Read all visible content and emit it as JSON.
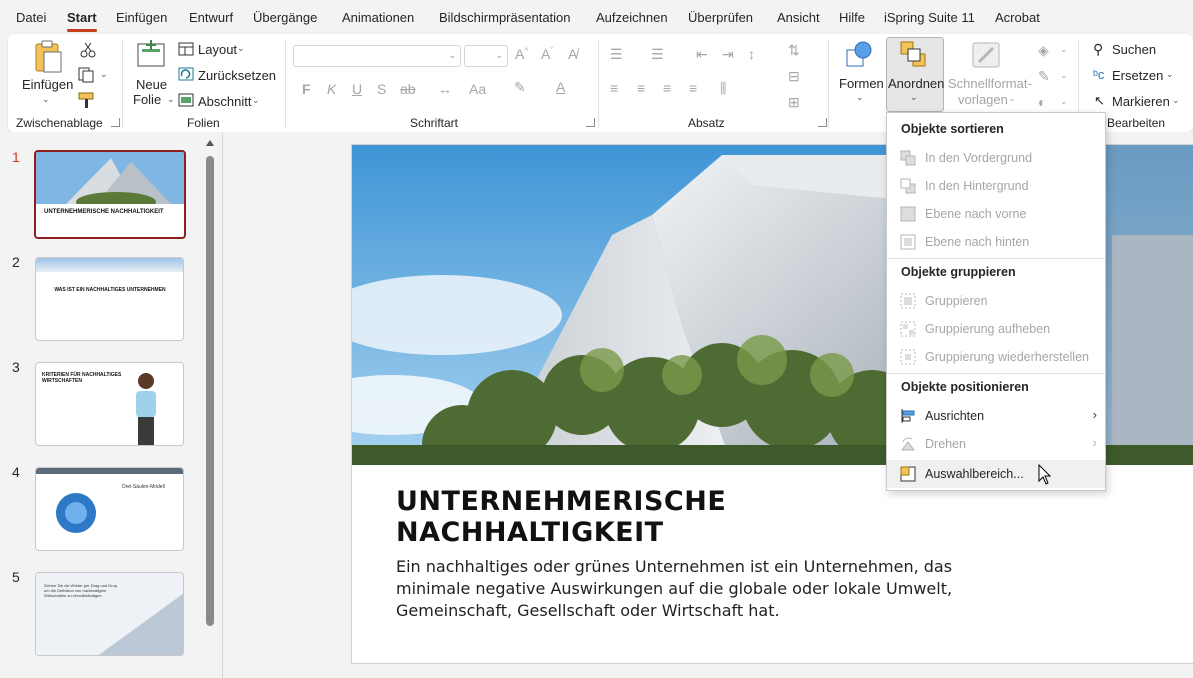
{
  "menubar": {
    "tabs": [
      {
        "label": "Datei"
      },
      {
        "label": "Start",
        "active": true
      },
      {
        "label": "Einfügen"
      },
      {
        "label": "Entwurf"
      },
      {
        "label": "Übergänge"
      },
      {
        "label": "Animationen"
      },
      {
        "label": "Bildschirmpräsentation"
      },
      {
        "label": "Aufzeichnen"
      },
      {
        "label": "Überprüfen"
      },
      {
        "label": "Ansicht"
      },
      {
        "label": "Hilfe"
      },
      {
        "label": "iSpring Suite 11"
      },
      {
        "label": "Acrobat"
      }
    ]
  },
  "ribbon": {
    "clipboard": {
      "paste_label": "Einfügen",
      "group_label": "Zwischenablage"
    },
    "slides": {
      "new_slide_line1": "Neue",
      "new_slide_line2": "Folie",
      "layout": "Layout",
      "reset": "Zurücksetzen",
      "section": "Abschnitt",
      "group_label": "Folien"
    },
    "font": {
      "group_label": "Schriftart",
      "bold": "F",
      "italic": "K",
      "underline": "U",
      "shadow": "S",
      "strike": "ab",
      "case": "Aa"
    },
    "paragraph": {
      "group_label": "Absatz"
    },
    "drawing": {
      "shapes_label": "Formen",
      "arrange_label": "Anordnen",
      "quickstyles_line1": "Schnellformat-",
      "quickstyles_line2": "vorlagen"
    },
    "editing": {
      "search": "Suchen",
      "replace": "Ersetzen",
      "select": "Markieren",
      "group_label": "Bearbeiten"
    }
  },
  "thumbnails": {
    "slides": [
      {
        "number": "1",
        "selected": true,
        "title": "UNTERNEHMERISCHE NACHHALTIGKEIT"
      },
      {
        "number": "2",
        "title": "WAS IST EIN NACHHALTIGES UNTERNEHMEN"
      },
      {
        "number": "3",
        "title": "KRITERIEN FÜR NACHHALTIGES WIRTSCHAFTEN"
      },
      {
        "number": "4",
        "title": "Drei-Säulen-Modell"
      },
      {
        "number": "5",
        "title": "Ziehen Sie die Wörter per Drag und Drop, um die Definition von nachhaltigem Wirtschaften zu vervollständigen"
      }
    ]
  },
  "slide": {
    "title": "UNTERNEHMERISCHE\nNACHHALTIGKEIT",
    "body": "Ein nachhaltiges oder grünes Unternehmen ist ein Unternehmen, das minimale negative Auswirkungen auf die globale oder lokale Umwelt, Gemeinschaft, Gesellschaft oder Wirtschaft hat."
  },
  "arrange_menu": {
    "sections": [
      {
        "header": "Objekte sortieren",
        "items": [
          {
            "label": "In den Vordergrund",
            "disabled": true
          },
          {
            "label": "In den Hintergrund",
            "disabled": true
          },
          {
            "label": "Ebene nach vorne",
            "disabled": true
          },
          {
            "label": "Ebene nach hinten",
            "disabled": true
          }
        ]
      },
      {
        "header": "Objekte gruppieren",
        "items": [
          {
            "label": "Gruppieren",
            "disabled": true
          },
          {
            "label": "Gruppierung aufheben",
            "disabled": true
          },
          {
            "label": "Gruppierung wiederherstellen",
            "disabled": true
          }
        ]
      },
      {
        "header": "Objekte positionieren",
        "items": [
          {
            "label": "Ausrichten",
            "disabled": false,
            "submenu": true
          },
          {
            "label": "Drehen",
            "disabled": true,
            "submenu": true
          },
          {
            "label": "Auswahlbereich...",
            "disabled": false
          }
        ]
      }
    ]
  },
  "colors": {
    "accent": "#c43e1c",
    "selected_thumb": "#8e1f1f"
  }
}
